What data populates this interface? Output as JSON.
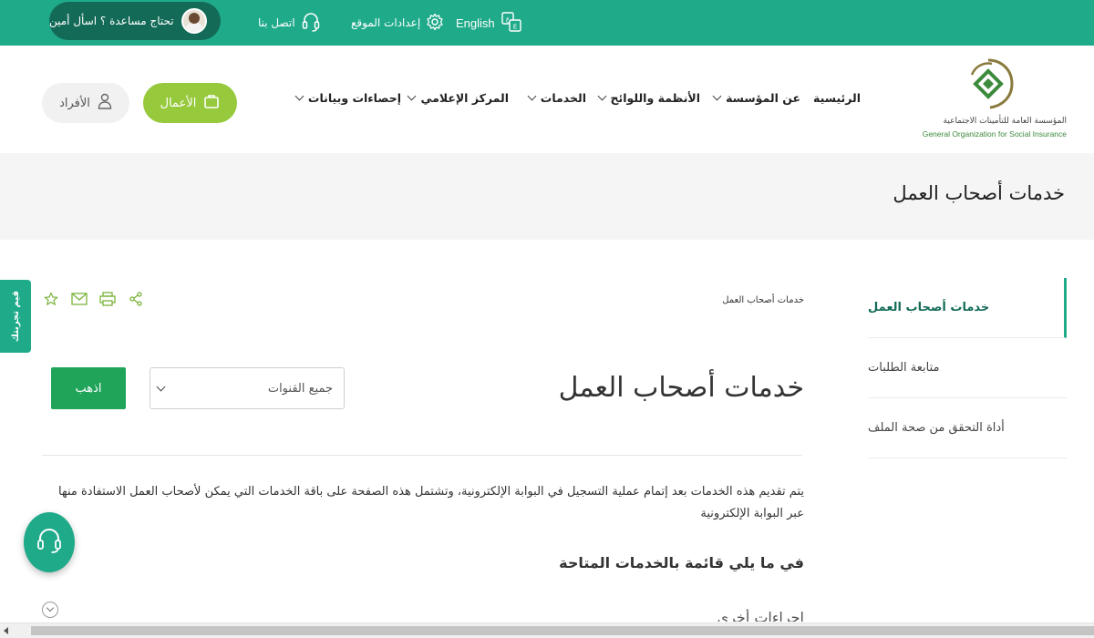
{
  "topbar": {
    "ask_amin": "تحتاج مساعدة ؟ اسأل أمين",
    "contact": "اتصل بنا",
    "settings": "إعدادات الموقع",
    "language": "English"
  },
  "logo": {
    "arabic": "المؤسسة العامة للتأمينات الاجتماعية",
    "english": "General Organization for Social Insurance"
  },
  "nav": {
    "home": "الرئيسية",
    "about": "عن المؤسسة",
    "regulations": "الأنظمة واللوائح",
    "services": "الخدمات",
    "media": "المركز الإعلامي",
    "stats": "إحصاءات وبيانات"
  },
  "auth": {
    "business": "الأعمال",
    "individuals": "الأفراد"
  },
  "page_title": "خدمات أصحاب العمل",
  "sidebar": {
    "items": [
      {
        "label": "خدمات أصحاب العمل"
      },
      {
        "label": "متابعة الطلبات"
      },
      {
        "label": "أداة التحقق من صحة الملف"
      }
    ]
  },
  "breadcrumb": "خدمات أصحاب العمل",
  "main": {
    "title": "خدمات أصحاب العمل",
    "channel_select": "جميع القنوات",
    "go_button": "اذهب",
    "intro": "يتم تقديم هذه الخدمات بعد إتمام عملية التسجيل في البوابة الإلكترونية، وتشتمل هذه الصفحة على باقة الخدمات التي يمكن لأصحاب العمل الاستفادة منها عبر البوابة الإلكترونية",
    "list_heading": "في ما يلي قائمة بالخدمات المتاحة",
    "other_section": "إجراءات أخرى"
  },
  "rate_tab": "قيم تجربتك",
  "colors": {
    "primary": "#1faa8a",
    "dark": "#136b57",
    "lime": "#97c93d",
    "go": "#1fa45a"
  }
}
